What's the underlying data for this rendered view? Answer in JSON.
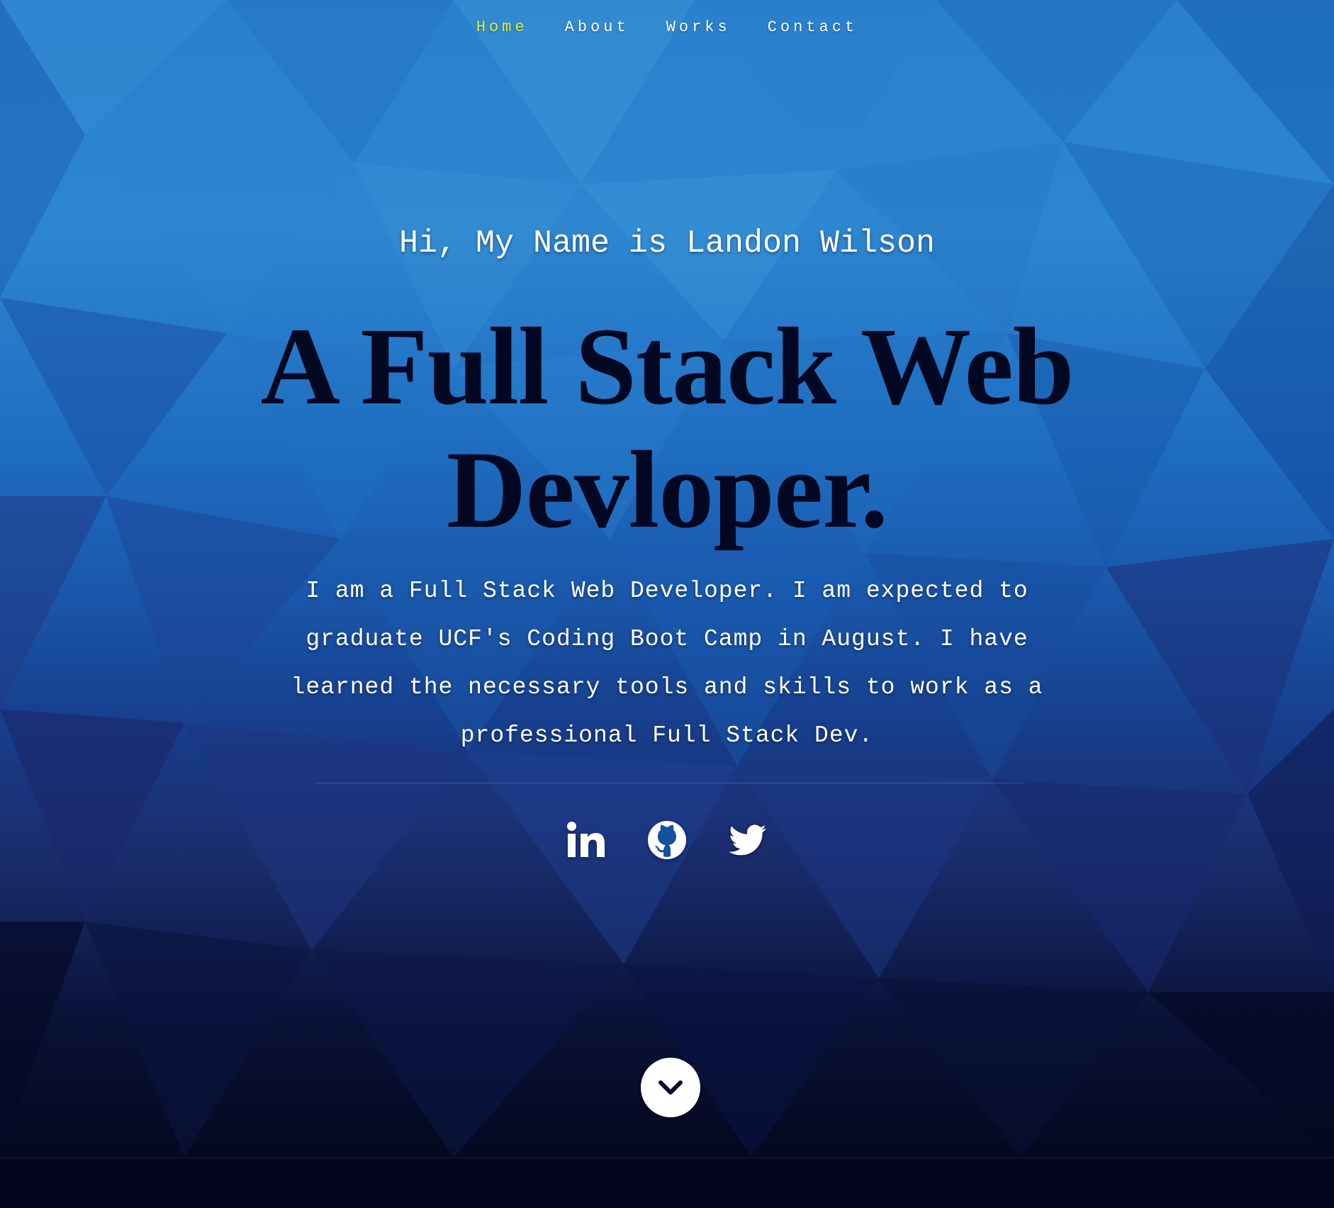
{
  "nav": {
    "items": [
      {
        "label": "Home",
        "active": true
      },
      {
        "label": "About",
        "active": false
      },
      {
        "label": "Works",
        "active": false
      },
      {
        "label": "Contact",
        "active": false
      }
    ]
  },
  "hero": {
    "intro": "Hi, My Name is Landon Wilson",
    "headline": "A Full Stack Web Devloper.",
    "bio": "I am a Full Stack Web Developer. I am expected to graduate UCF's Coding Boot Camp in August. I have learned the necessary tools and skills to work as a professional Full Stack Dev."
  },
  "socials": [
    {
      "icon": "linkedin-icon"
    },
    {
      "icon": "github-icon"
    },
    {
      "icon": "twitter-icon"
    }
  ],
  "scroll_button": {
    "icon": "chevron-down-icon"
  },
  "colors": {
    "nav_active": "#d7f53a",
    "nav_text": "#ffffff",
    "headline": "#030822",
    "background_top": "#2a80cc",
    "background_bottom": "#04081f"
  }
}
